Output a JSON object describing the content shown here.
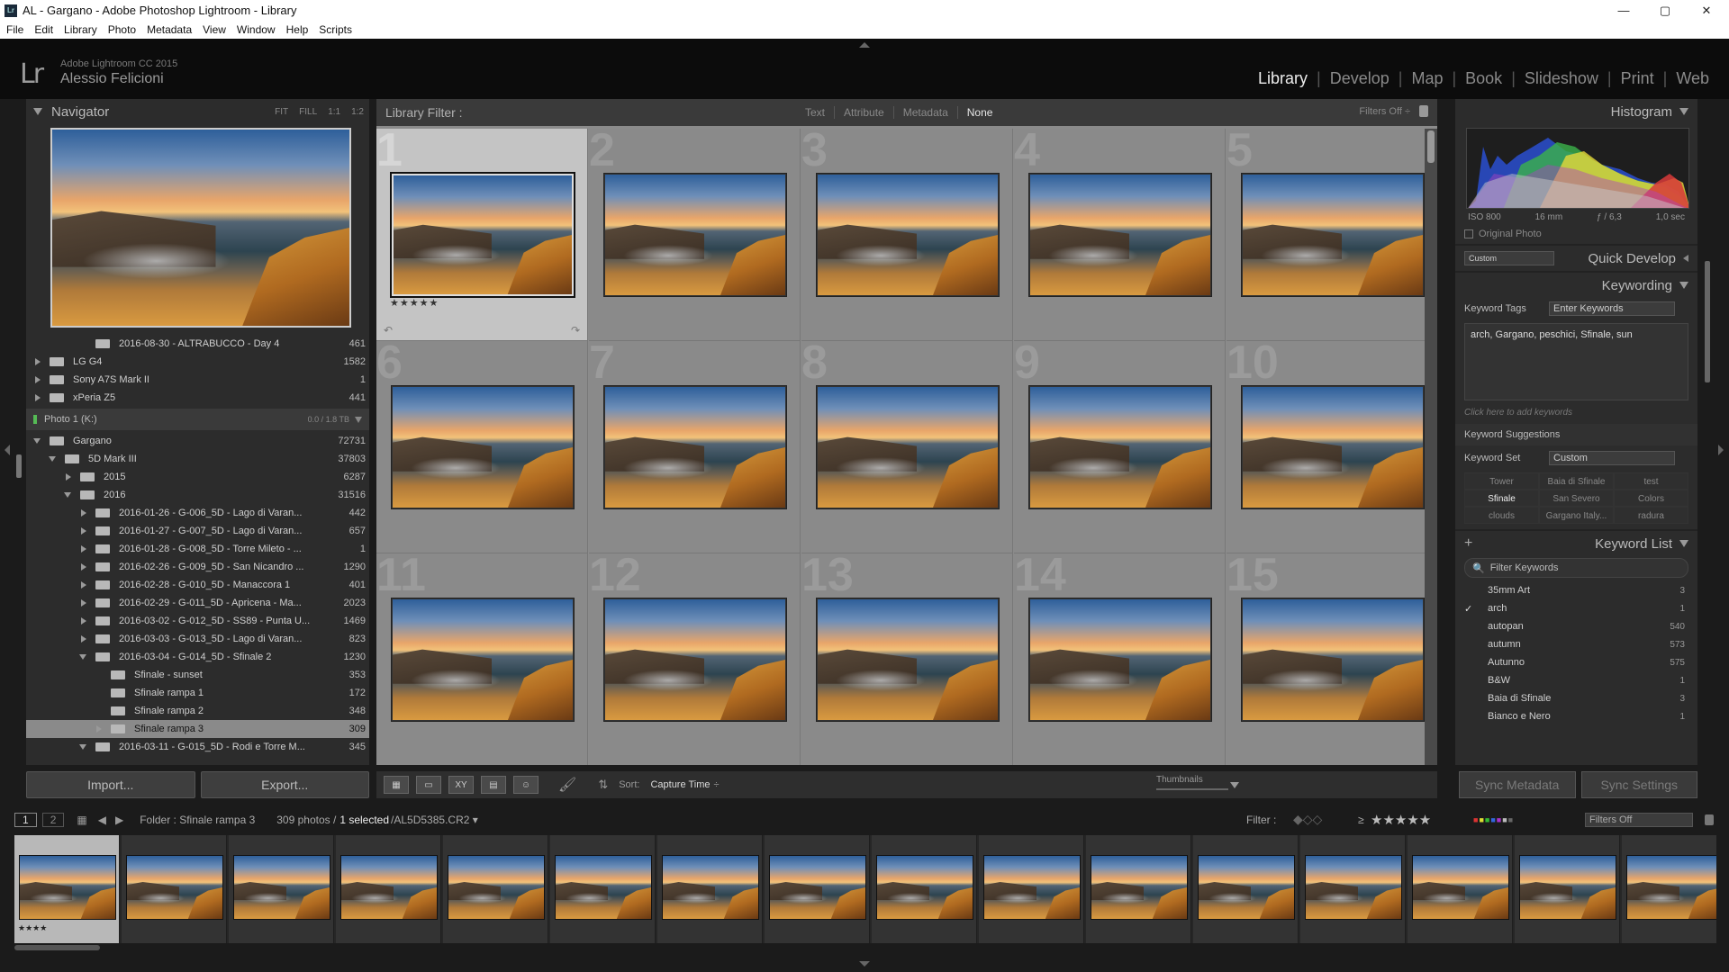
{
  "window": {
    "title": "AL - Gargano - Adobe Photoshop Lightroom - Library",
    "app_icon": "Lr"
  },
  "window_controls": {
    "minimize": "—",
    "maximize": "▢",
    "close": "✕"
  },
  "menu": [
    "File",
    "Edit",
    "Library",
    "Photo",
    "Metadata",
    "View",
    "Window",
    "Help",
    "Scripts"
  ],
  "identity": {
    "logo": "Lr",
    "version": "Adobe Lightroom CC 2015",
    "user": "Alessio Felicioni"
  },
  "modules": [
    "Library",
    "Develop",
    "Map",
    "Book",
    "Slideshow",
    "Print",
    "Web"
  ],
  "active_module": "Library",
  "navigator": {
    "title": "Navigator",
    "zoom": [
      "FIT",
      "FILL",
      "1:1",
      "1:2"
    ]
  },
  "folders": [
    {
      "name": "2016-08-30 - ALTRABUCCO - Day 4",
      "count": "461",
      "level": 3,
      "arrow": "none"
    },
    {
      "name": "LG G4",
      "count": "1582",
      "level": 0,
      "arrow": "right"
    },
    {
      "name": "Sony A7S Mark II",
      "count": "1",
      "level": 0,
      "arrow": "right"
    },
    {
      "name": "xPeria Z5",
      "count": "441",
      "level": 0,
      "arrow": "right"
    }
  ],
  "volume": {
    "name": "Photo 1 (K:)",
    "space": "0.0 / 1.8 TB"
  },
  "folders2": [
    {
      "name": "Gargano",
      "count": "72731",
      "level": 0,
      "arrow": "down"
    },
    {
      "name": "5D Mark III",
      "count": "37803",
      "level": 1,
      "arrow": "down"
    },
    {
      "name": "2015",
      "count": "6287",
      "level": 2,
      "arrow": "right"
    },
    {
      "name": "2016",
      "count": "31516",
      "level": 2,
      "arrow": "down"
    },
    {
      "name": "2016-01-26 - G-006_5D - Lago di Varan...",
      "count": "442",
      "level": 3,
      "arrow": "right"
    },
    {
      "name": "2016-01-27 - G-007_5D - Lago di Varan...",
      "count": "657",
      "level": 3,
      "arrow": "right"
    },
    {
      "name": "2016-01-28 - G-008_5D - Torre Mileto - ...",
      "count": "1",
      "level": 3,
      "arrow": "right"
    },
    {
      "name": "2016-02-26 - G-009_5D - San Nicandro ...",
      "count": "1290",
      "level": 3,
      "arrow": "right"
    },
    {
      "name": "2016-02-28 - G-010_5D - Manaccora 1",
      "count": "401",
      "level": 3,
      "arrow": "right"
    },
    {
      "name": "2016-02-29 - G-011_5D - Apricena - Ma...",
      "count": "2023",
      "level": 3,
      "arrow": "right"
    },
    {
      "name": "2016-03-02 - G-012_5D - SS89 - Punta U...",
      "count": "1469",
      "level": 3,
      "arrow": "right"
    },
    {
      "name": "2016-03-03 - G-013_5D - Lago di Varan...",
      "count": "823",
      "level": 3,
      "arrow": "right"
    },
    {
      "name": "2016-03-04 - G-014_5D - Sfinale 2",
      "count": "1230",
      "level": 3,
      "arrow": "down"
    },
    {
      "name": "Sfinale - sunset",
      "count": "353",
      "level": 4,
      "arrow": "none"
    },
    {
      "name": "Sfinale rampa 1",
      "count": "172",
      "level": 4,
      "arrow": "none"
    },
    {
      "name": "Sfinale rampa 2",
      "count": "348",
      "level": 4,
      "arrow": "none"
    },
    {
      "name": "Sfinale rampa 3",
      "count": "309",
      "level": 4,
      "arrow": "right",
      "selected": true
    },
    {
      "name": "2016-03-11 - G-015_5D - Rodi e Torre M...",
      "count": "345",
      "level": 3,
      "arrow": "down"
    }
  ],
  "buttons": {
    "import": "Import...",
    "export": "Export..."
  },
  "library_filter": {
    "label": "Library Filter :",
    "tabs": [
      "Text",
      "Attribute",
      "Metadata",
      "None"
    ],
    "active": "None",
    "status": "Filters Off ÷"
  },
  "grid": {
    "numbers": [
      "1",
      "2",
      "3",
      "4",
      "5",
      "6",
      "7",
      "8",
      "9",
      "10",
      "11",
      "12",
      "13",
      "14",
      "15"
    ],
    "selected_index": 0,
    "stars": "★★★★★"
  },
  "toolbar": {
    "sort_label": "Sort:",
    "sort_value": "Capture Time",
    "thumbnails_label": "Thumbnails"
  },
  "histogram": {
    "title": "Histogram",
    "iso": "ISO 800",
    "focal": "16 mm",
    "aperture": "ƒ / 6,3",
    "shutter": "1,0 sec",
    "original_photo": "Original Photo"
  },
  "quick_develop": {
    "title": "Quick Develop",
    "preset": "Custom"
  },
  "keywording": {
    "title": "Keywording",
    "tags_label": "Keyword Tags",
    "tags_mode": "Enter Keywords",
    "keywords": "arch, Gargano, peschici, Sfinale, sun",
    "add_hint": "Click here to add keywords",
    "suggestions_label": "Keyword Suggestions",
    "set_label": "Keyword Set",
    "set_value": "Custom",
    "set_items": [
      "Tower",
      "Baia di Sfinale",
      "test",
      "Sfinale",
      "San Severo",
      "Colors",
      "clouds",
      "Gargano Italy...",
      "radura"
    ]
  },
  "keyword_list": {
    "title": "Keyword List",
    "filter_placeholder": "Filter Keywords",
    "items": [
      {
        "name": "35mm Art",
        "count": "3",
        "checked": false
      },
      {
        "name": "arch",
        "count": "1",
        "checked": true
      },
      {
        "name": "autopan",
        "count": "540",
        "checked": false
      },
      {
        "name": "autumn",
        "count": "573",
        "checked": false
      },
      {
        "name": "Autunno",
        "count": "575",
        "checked": false
      },
      {
        "name": "B&W",
        "count": "1",
        "checked": false
      },
      {
        "name": "Baia di Sfinale",
        "count": "3",
        "checked": false
      },
      {
        "name": "Bianco e Nero",
        "count": "1",
        "checked": false
      }
    ]
  },
  "sync": {
    "metadata": "Sync Metadata",
    "settings": "Sync Settings"
  },
  "filmstrip": {
    "page1": "1",
    "page2": "2",
    "source": "Folder : Sfinale rampa 3",
    "count": "309 photos /",
    "selected": "1 selected",
    "file": "/AL5D5385.CR2 ▾",
    "filter_label": "Filter :",
    "rating_op": "≥",
    "rating_stars": "★★★★★",
    "filters_state": "Filters Off",
    "thumbs": 16,
    "selected_stars": "★★★★"
  },
  "colors": {
    "accent": "#ededed",
    "panel": "#2c2c2c",
    "grid": "#8b8b8b"
  }
}
